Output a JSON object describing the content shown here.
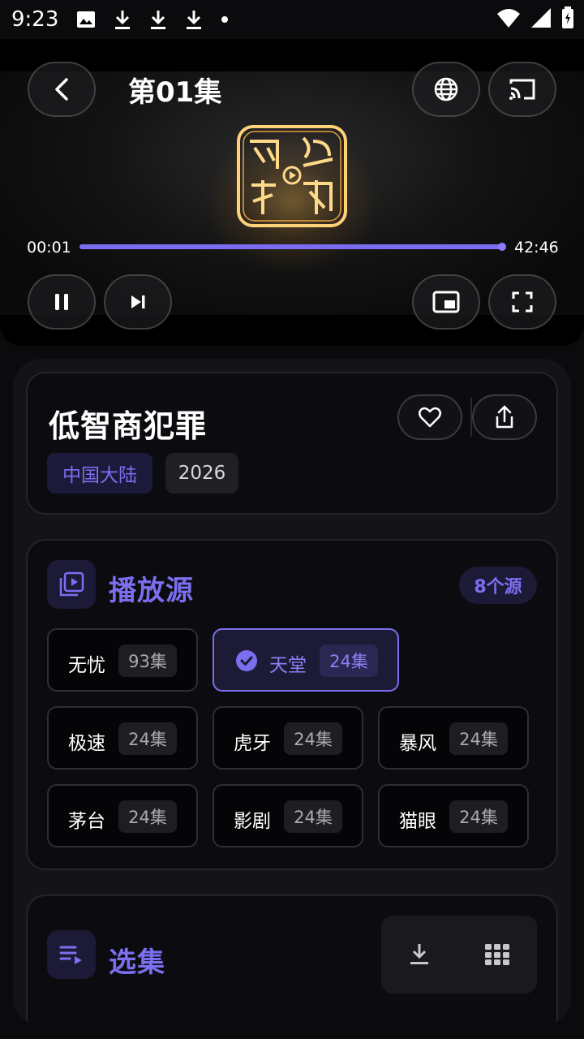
{
  "status_bar": {
    "time": "9:23"
  },
  "player": {
    "episode_title": "第01集",
    "current_time": "00:01",
    "duration": "42:46",
    "progress_fraction": 0.995
  },
  "show": {
    "title": "低智商犯罪",
    "tags": {
      "region": "中国大陆",
      "year": "2026"
    }
  },
  "sources_section": {
    "title": "播放源",
    "count_badge": "8个源",
    "sources": [
      {
        "name": "无忧",
        "episodes": "93集",
        "selected": false
      },
      {
        "name": "天堂",
        "episodes": "24集",
        "selected": true
      },
      {
        "name": "极速",
        "episodes": "24集",
        "selected": false
      },
      {
        "name": "虎牙",
        "episodes": "24集",
        "selected": false
      },
      {
        "name": "暴风",
        "episodes": "24集",
        "selected": false
      },
      {
        "name": "茅台",
        "episodes": "24集",
        "selected": false
      },
      {
        "name": "影剧",
        "episodes": "24集",
        "selected": false
      },
      {
        "name": "猫眼",
        "episodes": "24集",
        "selected": false
      }
    ]
  },
  "episodes_section": {
    "title": "选集"
  },
  "colors": {
    "accent": "#7b6ff0",
    "background": "#0b0b0d",
    "card": "#0c0c10"
  },
  "icons": [
    "back-icon",
    "globe-icon",
    "cast-icon",
    "pause-icon",
    "skip-next-icon",
    "pip-icon",
    "fullscreen-icon",
    "heart-icon",
    "share-icon",
    "playlist-play-icon",
    "check-circle-icon",
    "queue-music-icon",
    "download-icon",
    "grid-icon"
  ]
}
